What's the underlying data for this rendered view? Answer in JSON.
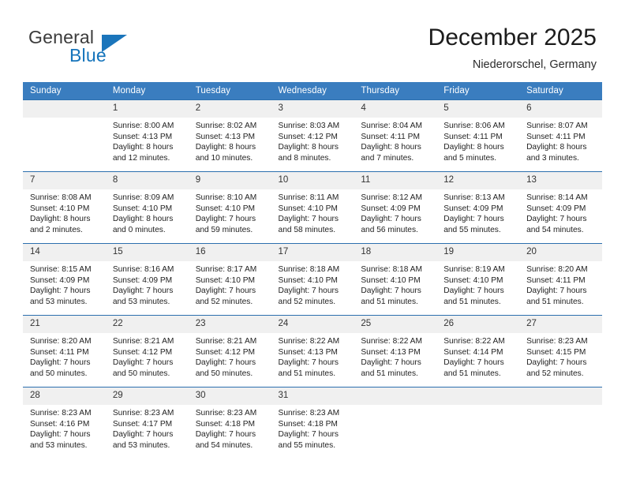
{
  "brand": {
    "word_one": "General",
    "word_two": "Blue",
    "logo_icon": "triangle-icon"
  },
  "header": {
    "title": "December 2025",
    "subtitle": "Niederorschel, Germany"
  },
  "colors": {
    "header_blue": "#3a7dbf",
    "rule_blue": "#2c6fae",
    "daynum_gray": "#f0f0f0",
    "brand_blue": "#1b75bb"
  },
  "weekday_headers": [
    "Sunday",
    "Monday",
    "Tuesday",
    "Wednesday",
    "Thursday",
    "Friday",
    "Saturday"
  ],
  "weeks": [
    [
      {
        "day": "",
        "blank": true,
        "sunrise": "",
        "sunset": "",
        "daylight1": "",
        "daylight2": ""
      },
      {
        "day": "1",
        "sunrise": "Sunrise: 8:00 AM",
        "sunset": "Sunset: 4:13 PM",
        "daylight1": "Daylight: 8 hours",
        "daylight2": "and 12 minutes."
      },
      {
        "day": "2",
        "sunrise": "Sunrise: 8:02 AM",
        "sunset": "Sunset: 4:13 PM",
        "daylight1": "Daylight: 8 hours",
        "daylight2": "and 10 minutes."
      },
      {
        "day": "3",
        "sunrise": "Sunrise: 8:03 AM",
        "sunset": "Sunset: 4:12 PM",
        "daylight1": "Daylight: 8 hours",
        "daylight2": "and 8 minutes."
      },
      {
        "day": "4",
        "sunrise": "Sunrise: 8:04 AM",
        "sunset": "Sunset: 4:11 PM",
        "daylight1": "Daylight: 8 hours",
        "daylight2": "and 7 minutes."
      },
      {
        "day": "5",
        "sunrise": "Sunrise: 8:06 AM",
        "sunset": "Sunset: 4:11 PM",
        "daylight1": "Daylight: 8 hours",
        "daylight2": "and 5 minutes."
      },
      {
        "day": "6",
        "sunrise": "Sunrise: 8:07 AM",
        "sunset": "Sunset: 4:11 PM",
        "daylight1": "Daylight: 8 hours",
        "daylight2": "and 3 minutes."
      }
    ],
    [
      {
        "day": "7",
        "sunrise": "Sunrise: 8:08 AM",
        "sunset": "Sunset: 4:10 PM",
        "daylight1": "Daylight: 8 hours",
        "daylight2": "and 2 minutes."
      },
      {
        "day": "8",
        "sunrise": "Sunrise: 8:09 AM",
        "sunset": "Sunset: 4:10 PM",
        "daylight1": "Daylight: 8 hours",
        "daylight2": "and 0 minutes."
      },
      {
        "day": "9",
        "sunrise": "Sunrise: 8:10 AM",
        "sunset": "Sunset: 4:10 PM",
        "daylight1": "Daylight: 7 hours",
        "daylight2": "and 59 minutes."
      },
      {
        "day": "10",
        "sunrise": "Sunrise: 8:11 AM",
        "sunset": "Sunset: 4:10 PM",
        "daylight1": "Daylight: 7 hours",
        "daylight2": "and 58 minutes."
      },
      {
        "day": "11",
        "sunrise": "Sunrise: 8:12 AM",
        "sunset": "Sunset: 4:09 PM",
        "daylight1": "Daylight: 7 hours",
        "daylight2": "and 56 minutes."
      },
      {
        "day": "12",
        "sunrise": "Sunrise: 8:13 AM",
        "sunset": "Sunset: 4:09 PM",
        "daylight1": "Daylight: 7 hours",
        "daylight2": "and 55 minutes."
      },
      {
        "day": "13",
        "sunrise": "Sunrise: 8:14 AM",
        "sunset": "Sunset: 4:09 PM",
        "daylight1": "Daylight: 7 hours",
        "daylight2": "and 54 minutes."
      }
    ],
    [
      {
        "day": "14",
        "sunrise": "Sunrise: 8:15 AM",
        "sunset": "Sunset: 4:09 PM",
        "daylight1": "Daylight: 7 hours",
        "daylight2": "and 53 minutes."
      },
      {
        "day": "15",
        "sunrise": "Sunrise: 8:16 AM",
        "sunset": "Sunset: 4:09 PM",
        "daylight1": "Daylight: 7 hours",
        "daylight2": "and 53 minutes."
      },
      {
        "day": "16",
        "sunrise": "Sunrise: 8:17 AM",
        "sunset": "Sunset: 4:10 PM",
        "daylight1": "Daylight: 7 hours",
        "daylight2": "and 52 minutes."
      },
      {
        "day": "17",
        "sunrise": "Sunrise: 8:18 AM",
        "sunset": "Sunset: 4:10 PM",
        "daylight1": "Daylight: 7 hours",
        "daylight2": "and 52 minutes."
      },
      {
        "day": "18",
        "sunrise": "Sunrise: 8:18 AM",
        "sunset": "Sunset: 4:10 PM",
        "daylight1": "Daylight: 7 hours",
        "daylight2": "and 51 minutes."
      },
      {
        "day": "19",
        "sunrise": "Sunrise: 8:19 AM",
        "sunset": "Sunset: 4:10 PM",
        "daylight1": "Daylight: 7 hours",
        "daylight2": "and 51 minutes."
      },
      {
        "day": "20",
        "sunrise": "Sunrise: 8:20 AM",
        "sunset": "Sunset: 4:11 PM",
        "daylight1": "Daylight: 7 hours",
        "daylight2": "and 51 minutes."
      }
    ],
    [
      {
        "day": "21",
        "sunrise": "Sunrise: 8:20 AM",
        "sunset": "Sunset: 4:11 PM",
        "daylight1": "Daylight: 7 hours",
        "daylight2": "and 50 minutes."
      },
      {
        "day": "22",
        "sunrise": "Sunrise: 8:21 AM",
        "sunset": "Sunset: 4:12 PM",
        "daylight1": "Daylight: 7 hours",
        "daylight2": "and 50 minutes."
      },
      {
        "day": "23",
        "sunrise": "Sunrise: 8:21 AM",
        "sunset": "Sunset: 4:12 PM",
        "daylight1": "Daylight: 7 hours",
        "daylight2": "and 50 minutes."
      },
      {
        "day": "24",
        "sunrise": "Sunrise: 8:22 AM",
        "sunset": "Sunset: 4:13 PM",
        "daylight1": "Daylight: 7 hours",
        "daylight2": "and 51 minutes."
      },
      {
        "day": "25",
        "sunrise": "Sunrise: 8:22 AM",
        "sunset": "Sunset: 4:13 PM",
        "daylight1": "Daylight: 7 hours",
        "daylight2": "and 51 minutes."
      },
      {
        "day": "26",
        "sunrise": "Sunrise: 8:22 AM",
        "sunset": "Sunset: 4:14 PM",
        "daylight1": "Daylight: 7 hours",
        "daylight2": "and 51 minutes."
      },
      {
        "day": "27",
        "sunrise": "Sunrise: 8:23 AM",
        "sunset": "Sunset: 4:15 PM",
        "daylight1": "Daylight: 7 hours",
        "daylight2": "and 52 minutes."
      }
    ],
    [
      {
        "day": "28",
        "sunrise": "Sunrise: 8:23 AM",
        "sunset": "Sunset: 4:16 PM",
        "daylight1": "Daylight: 7 hours",
        "daylight2": "and 53 minutes."
      },
      {
        "day": "29",
        "sunrise": "Sunrise: 8:23 AM",
        "sunset": "Sunset: 4:17 PM",
        "daylight1": "Daylight: 7 hours",
        "daylight2": "and 53 minutes."
      },
      {
        "day": "30",
        "sunrise": "Sunrise: 8:23 AM",
        "sunset": "Sunset: 4:18 PM",
        "daylight1": "Daylight: 7 hours",
        "daylight2": "and 54 minutes."
      },
      {
        "day": "31",
        "sunrise": "Sunrise: 8:23 AM",
        "sunset": "Sunset: 4:18 PM",
        "daylight1": "Daylight: 7 hours",
        "daylight2": "and 55 minutes."
      },
      {
        "day": "",
        "blank": true,
        "sunrise": "",
        "sunset": "",
        "daylight1": "",
        "daylight2": ""
      },
      {
        "day": "",
        "blank": true,
        "sunrise": "",
        "sunset": "",
        "daylight1": "",
        "daylight2": ""
      },
      {
        "day": "",
        "blank": true,
        "sunrise": "",
        "sunset": "",
        "daylight1": "",
        "daylight2": ""
      }
    ]
  ]
}
